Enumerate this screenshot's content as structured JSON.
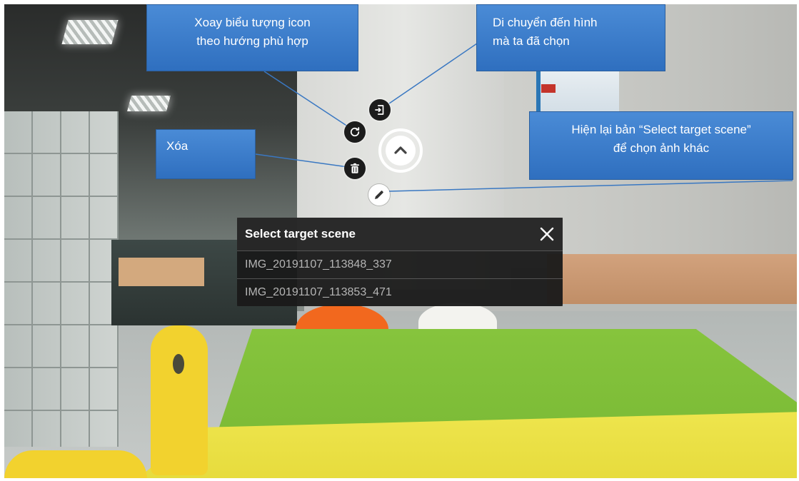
{
  "callouts": {
    "rotate": {
      "line1": "Xoay biểu tượng icon",
      "line2": "theo hướng phù hợp"
    },
    "move": {
      "line1": "Di chuyển đến hình",
      "line2": "mà ta đã chọn"
    },
    "delete": {
      "line1": "Xóa"
    },
    "reselect": {
      "line1": "Hiện lại bản “Select target scene”",
      "line2": "để chọn ảnh khác"
    }
  },
  "tools": {
    "move_icon": "open-target-icon",
    "rotate_icon": "rotate-icon",
    "delete_icon": "trash-icon",
    "edit_icon": "pencil-icon",
    "hotspot_icon": "chevron-up-icon"
  },
  "scene_panel": {
    "title": "Select target scene",
    "items": [
      {
        "label": "IMG_20191107_113848_337"
      },
      {
        "label": "IMG_20191107_113853_471"
      }
    ]
  },
  "colors": {
    "callout_fill": "#3a7cca",
    "panel_bg": "#1e1e1e",
    "panel_text": "#b5b5b5"
  }
}
